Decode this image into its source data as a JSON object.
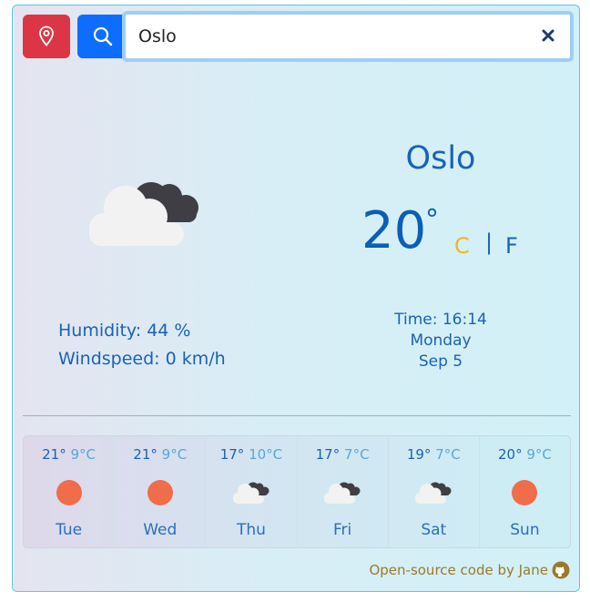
{
  "search": {
    "value": "Oslo",
    "placeholder": ""
  },
  "current": {
    "city": "Oslo",
    "temperature": "20",
    "degree_symbol": "°",
    "unit_c": "C",
    "unit_separator": "|",
    "unit_f": "F",
    "humidity": "Humidity: 44 %",
    "windspeed": "Windspeed: 0 km/h",
    "time": "Time: 16:14",
    "weekday": "Monday",
    "date": "Sep 5",
    "icon": "cloudy-icon"
  },
  "forecast": [
    {
      "hi": "21",
      "lo": "9",
      "day": "Tue",
      "icon": "sun-icon"
    },
    {
      "hi": "21",
      "lo": "9",
      "day": "Wed",
      "icon": "sun-icon"
    },
    {
      "hi": "17",
      "lo": "10",
      "day": "Thu",
      "icon": "cloudy-icon"
    },
    {
      "hi": "17",
      "lo": "7",
      "day": "Fri",
      "icon": "cloudy-icon"
    },
    {
      "hi": "19",
      "lo": "7",
      "day": "Sat",
      "icon": "cloudy-icon"
    },
    {
      "hi": "20",
      "lo": "9",
      "day": "Sun",
      "icon": "sun-icon"
    }
  ],
  "forecast_unit": "°C",
  "deg": "°",
  "credit": {
    "text": "Open-source code by Jane"
  },
  "colors": {
    "location_button": "#dc3545",
    "search_button": "#0d6efd",
    "accent_text": "#1763b8",
    "celsius_active": "#f0b429",
    "sun": "#ef6d4a"
  }
}
